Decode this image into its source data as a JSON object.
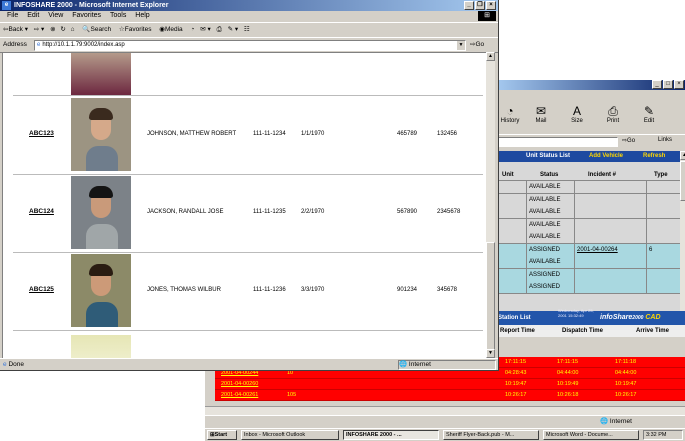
{
  "front_window": {
    "title": "INFOSHARE 2000 - Microsoft Internet Explorer",
    "menu": [
      "File",
      "Edit",
      "View",
      "Favorites",
      "Tools",
      "Help"
    ],
    "toolbar": {
      "back": "Back",
      "search": "Search",
      "favorites": "Favorites",
      "media": "Media"
    },
    "address": {
      "label": "Address",
      "url": "http://10.1.1.79:9002/index.asp",
      "go": "Go"
    },
    "rows": [
      {
        "unit": "ABC123",
        "name": "JOHNSON, MATTHEW ROBERT",
        "ssn": "111-11-1234",
        "dob": "1/1/1970",
        "num1": "465789",
        "num2": "132456"
      },
      {
        "unit": "ABC124",
        "name": "JACKSON, RANDALL JOSE",
        "ssn": "111-11-1235",
        "dob": "2/2/1970",
        "num1": "567890",
        "num2": "2345678"
      },
      {
        "unit": "ABC125",
        "name": "JONES, THOMAS WILBUR",
        "ssn": "111-11-1236",
        "dob": "3/3/1970",
        "num1": "901234",
        "num2": "345678"
      }
    ],
    "status": {
      "left": "Done",
      "zone": "Internet"
    }
  },
  "back_window": {
    "toolbar": [
      "History",
      "Mail",
      "Size",
      "Print",
      "Edit"
    ],
    "go": "Go",
    "links": "Links",
    "unit_status": {
      "tabs": [
        "Unit Status List",
        "Add Vehicle",
        "Refresh"
      ],
      "headers": [
        "Unit",
        "Status",
        "Incident #",
        "Type"
      ],
      "rows": [
        {
          "status": "AVAILABLE",
          "incident": "",
          "type": "",
          "highlight": false
        },
        {
          "status": "AVAILABLE",
          "incident": "",
          "type": "",
          "highlight": false
        },
        {
          "status": "AVAILABLE",
          "incident": "",
          "type": "",
          "highlight": false
        },
        {
          "status": "AVAILABLE",
          "incident": "",
          "type": "",
          "highlight": false
        },
        {
          "status": "AVAILABLE",
          "incident": "",
          "type": "",
          "highlight": false
        },
        {
          "status": "ASSIGNED",
          "incident": "2001-04-00264",
          "type": "6",
          "highlight": true
        },
        {
          "status": "AVAILABLE",
          "incident": "",
          "type": "",
          "highlight": true
        },
        {
          "status": "ASSIGNED",
          "incident": "",
          "type": "",
          "highlight": true
        },
        {
          "status": "ASSIGNED",
          "incident": "",
          "type": "",
          "highlight": true
        }
      ]
    },
    "banner": {
      "left": "Station List",
      "date": "Wednesday, Apr 25, 2001 15:32:49",
      "brand": "infoShare",
      "brand_suffix": "2000",
      "cad": "CAD"
    },
    "dispatch_headers": [
      "Report Time",
      "Dispatch Time",
      "Arrive Time"
    ],
    "dispatch_rows": [
      {
        "incident": "",
        "code": "",
        "report": "17:11:15",
        "dispatch": "17:11:15",
        "arrive": "17:11:18"
      },
      {
        "incident": "2001-04-00244",
        "code": "10",
        "report": "04:28:43",
        "dispatch": "04:44:00",
        "arrive": "04:44:00"
      },
      {
        "incident": "2001-04-00260",
        "code": "",
        "report": "10:19:47",
        "dispatch": "10:19:49",
        "arrive": "10:19:47"
      },
      {
        "incident": "2001-04-00261",
        "code": "105",
        "report": "10:26:17",
        "dispatch": "10:26:18",
        "arrive": "10:26:17"
      }
    ],
    "status_zone": "Internet"
  },
  "taskbar": {
    "start": "Start",
    "tasks": [
      "Inbox - Microsoft Outlook",
      "INFOSHARE 2000 - ...",
      "Sheriff Flyer-Back.pub - M...",
      "Microsoft Word - Docume..."
    ],
    "clock": "3:32 PM"
  }
}
